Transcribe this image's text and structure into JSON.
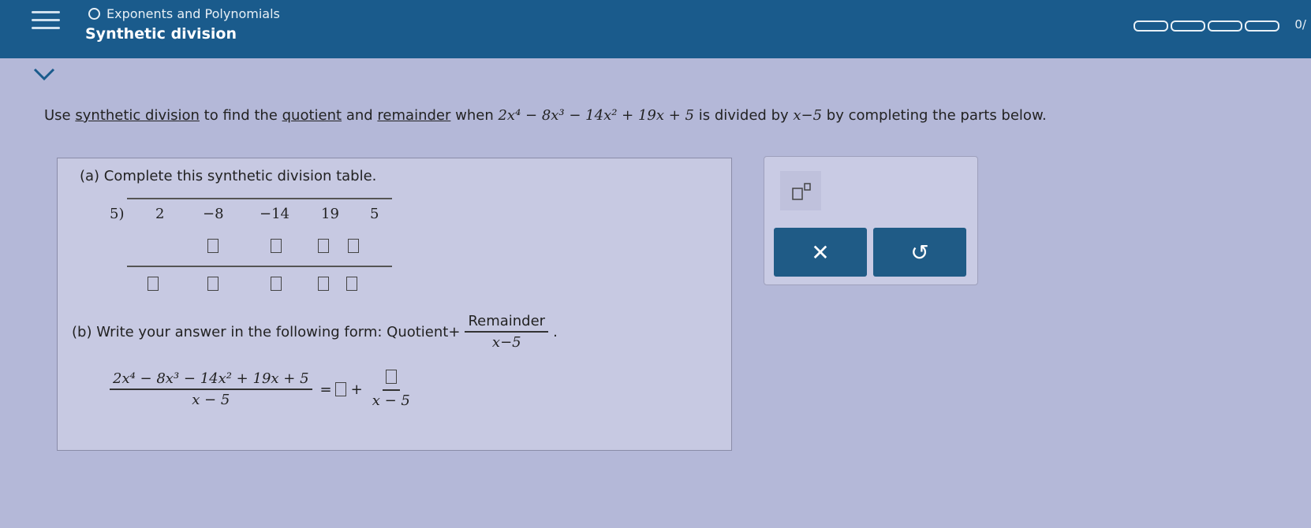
{
  "header": {
    "topic": "Exponents and Polynomials",
    "subtopic": "Synthetic division",
    "progress_label": "0/"
  },
  "question": {
    "prefix": "Use",
    "link1": "synthetic division",
    "mid1": "to find the",
    "link2": "quotient",
    "mid2": "and",
    "link3": "remainder",
    "mid3": "when",
    "poly": "2x⁴ − 8x³ − 14x² + 19x + 5",
    "mid4": "is divided by",
    "divisor": "x−5",
    "suffix": "by completing the parts below."
  },
  "part_a": {
    "label": "(a) Complete this synthetic division table.",
    "divisor": "5)",
    "coefficients": [
      "2",
      "−8",
      "−14",
      "19",
      "5"
    ]
  },
  "part_b": {
    "label": "(b) Write your answer in the following form: Quotient+",
    "frac_num": "Remainder",
    "frac_den": "x−5",
    "period": "."
  },
  "final_eq": {
    "lhs_num": "2x⁴ − 8x³ − 14x² + 19x + 5",
    "lhs_den": "x − 5",
    "equals": "=",
    "plus": "+",
    "rhs_den": "x − 5"
  },
  "side": {
    "clear_label": "✕",
    "undo_label": "↺"
  }
}
